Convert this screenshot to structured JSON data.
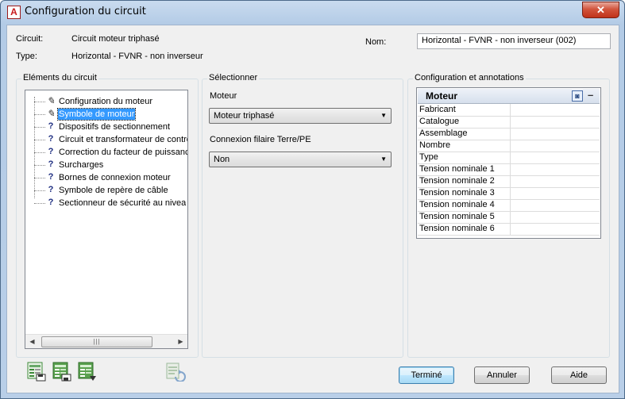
{
  "window": {
    "title": "Configuration du circuit",
    "close_label": "✕"
  },
  "header": {
    "circuit_label": "Circuit:",
    "circuit_value": "Circuit moteur triphasé",
    "type_label": "Type:",
    "type_value": "Horizontal - FVNR - non inverseur",
    "nom_label": "Nom:",
    "nom_value": "Horizontal - FVNR - non inverseur (002)"
  },
  "elements": {
    "title": "Eléments du circuit",
    "items": [
      {
        "label": "Configuration du moteur",
        "icon": "pencil-icon",
        "glyph": "✎"
      },
      {
        "label": "Symbole de moteur",
        "icon": "pencil-icon",
        "glyph": "✎"
      },
      {
        "label": "Dispositifs de sectionnement",
        "icon": "question-icon",
        "glyph": "?"
      },
      {
        "label": "Circuit et transformateur de contrô",
        "icon": "question-icon",
        "glyph": "?"
      },
      {
        "label": "Correction du facteur de puissanc",
        "icon": "question-icon",
        "glyph": "?"
      },
      {
        "label": "Surcharges",
        "icon": "question-icon",
        "glyph": "?"
      },
      {
        "label": "Bornes de connexion moteur",
        "icon": "question-icon",
        "glyph": "?"
      },
      {
        "label": "Symbole de repère de câble",
        "icon": "question-icon",
        "glyph": "?"
      },
      {
        "label": "Sectionneur de sécurité au nivea",
        "icon": "question-icon",
        "glyph": "?"
      }
    ],
    "selected_index": 1,
    "scroll_left": "◀",
    "scroll_right": "▶",
    "scroll_thumb": "|||"
  },
  "select_panel": {
    "title": "Sélectionner",
    "moteur_label": "Moteur",
    "moteur_value": "Moteur triphasé",
    "connexion_label": "Connexion filaire Terre/PE",
    "connexion_value": "Non",
    "arrow": "▼"
  },
  "config": {
    "title": "Configuration et annotations",
    "header": "Moteur",
    "header_btn": "◙",
    "header_min": "–",
    "rows": [
      "Fabricant",
      "Catalogue",
      "Assemblage",
      "Nombre",
      "Type",
      "Tension nominale 1",
      "Tension nominale 2",
      "Tension nominale 3",
      "Tension nominale 4",
      "Tension nominale 5",
      "Tension nominale 6"
    ]
  },
  "buttons": {
    "ok": "Terminé",
    "cancel": "Annuler",
    "help": "Aide"
  },
  "colors": {
    "selection": "#3399ff",
    "icon_green": "#3e8a3a",
    "tree_question": "#1d2d80"
  }
}
